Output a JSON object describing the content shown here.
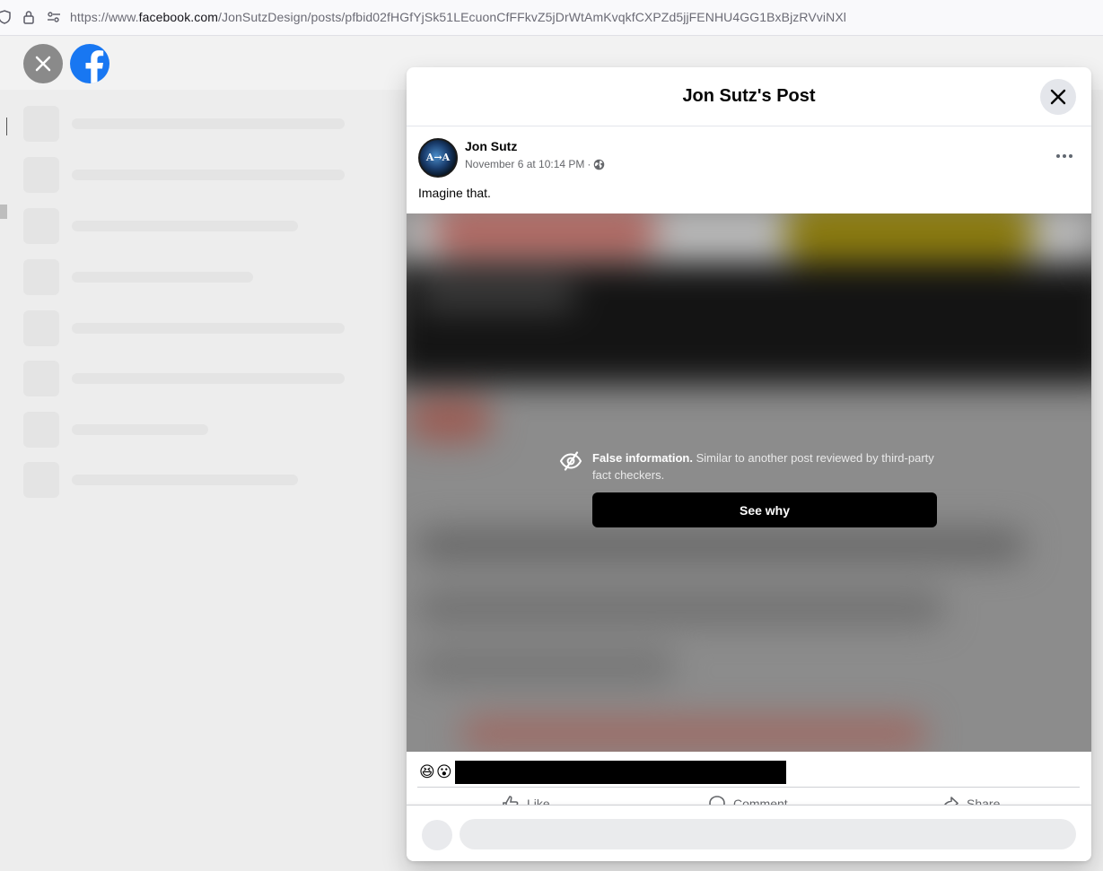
{
  "browser": {
    "url_prefix": "https://www.",
    "url_host": "facebook.com",
    "url_path": "/JonSutzDesign/posts/pfbid02fHGfYjSk51LEcuonCfFFkvZ5jDrWtAmKvqkfCXPZd5jjFENHU4GG1BxBjzRVviNXl",
    "icons": [
      "shield-icon",
      "lock-icon",
      "permissions-icon"
    ]
  },
  "modal": {
    "title": "Jon Sutz's Post",
    "close_icon": "close-icon"
  },
  "post": {
    "author": "Jon Sutz",
    "avatar_label": "A→A",
    "timestamp": "November 6 at 10:14 PM",
    "separator": "·",
    "audience_icon": "globe-icon",
    "text": "Imagine that."
  },
  "warning": {
    "heading": "False information.",
    "body": " Similar to another post reviewed by third-party fact checkers.",
    "button": "See why",
    "icon": "eye-slash-icon"
  },
  "reactions": {
    "emojis": [
      "😆",
      "😮"
    ]
  },
  "actions": {
    "like": "Like",
    "comment": "Comment",
    "share": "Share"
  },
  "colors": {
    "brand": "#1877f2",
    "button_bg": "#000000",
    "secondary_text": "#65676b"
  }
}
